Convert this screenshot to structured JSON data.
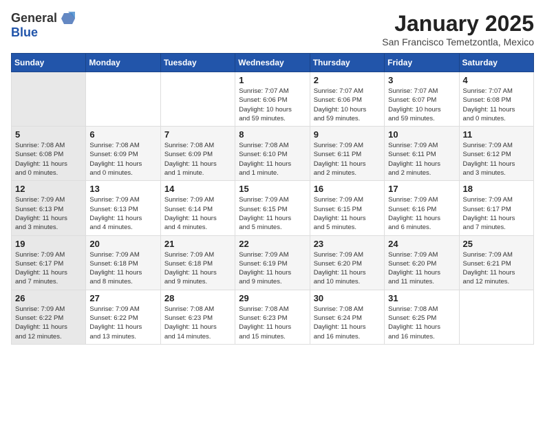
{
  "header": {
    "logo_general": "General",
    "logo_blue": "Blue",
    "month_title": "January 2025",
    "subtitle": "San Francisco Temetzontla, Mexico"
  },
  "weekdays": [
    "Sunday",
    "Monday",
    "Tuesday",
    "Wednesday",
    "Thursday",
    "Friday",
    "Saturday"
  ],
  "weeks": [
    [
      {
        "day": "",
        "info": ""
      },
      {
        "day": "",
        "info": ""
      },
      {
        "day": "",
        "info": ""
      },
      {
        "day": "1",
        "info": "Sunrise: 7:07 AM\nSunset: 6:06 PM\nDaylight: 10 hours\nand 59 minutes."
      },
      {
        "day": "2",
        "info": "Sunrise: 7:07 AM\nSunset: 6:06 PM\nDaylight: 10 hours\nand 59 minutes."
      },
      {
        "day": "3",
        "info": "Sunrise: 7:07 AM\nSunset: 6:07 PM\nDaylight: 10 hours\nand 59 minutes."
      },
      {
        "day": "4",
        "info": "Sunrise: 7:07 AM\nSunset: 6:08 PM\nDaylight: 11 hours\nand 0 minutes."
      }
    ],
    [
      {
        "day": "5",
        "info": "Sunrise: 7:08 AM\nSunset: 6:08 PM\nDaylight: 11 hours\nand 0 minutes."
      },
      {
        "day": "6",
        "info": "Sunrise: 7:08 AM\nSunset: 6:09 PM\nDaylight: 11 hours\nand 0 minutes."
      },
      {
        "day": "7",
        "info": "Sunrise: 7:08 AM\nSunset: 6:09 PM\nDaylight: 11 hours\nand 1 minute."
      },
      {
        "day": "8",
        "info": "Sunrise: 7:08 AM\nSunset: 6:10 PM\nDaylight: 11 hours\nand 1 minute."
      },
      {
        "day": "9",
        "info": "Sunrise: 7:09 AM\nSunset: 6:11 PM\nDaylight: 11 hours\nand 2 minutes."
      },
      {
        "day": "10",
        "info": "Sunrise: 7:09 AM\nSunset: 6:11 PM\nDaylight: 11 hours\nand 2 minutes."
      },
      {
        "day": "11",
        "info": "Sunrise: 7:09 AM\nSunset: 6:12 PM\nDaylight: 11 hours\nand 3 minutes."
      }
    ],
    [
      {
        "day": "12",
        "info": "Sunrise: 7:09 AM\nSunset: 6:13 PM\nDaylight: 11 hours\nand 3 minutes."
      },
      {
        "day": "13",
        "info": "Sunrise: 7:09 AM\nSunset: 6:13 PM\nDaylight: 11 hours\nand 4 minutes."
      },
      {
        "day": "14",
        "info": "Sunrise: 7:09 AM\nSunset: 6:14 PM\nDaylight: 11 hours\nand 4 minutes."
      },
      {
        "day": "15",
        "info": "Sunrise: 7:09 AM\nSunset: 6:15 PM\nDaylight: 11 hours\nand 5 minutes."
      },
      {
        "day": "16",
        "info": "Sunrise: 7:09 AM\nSunset: 6:15 PM\nDaylight: 11 hours\nand 5 minutes."
      },
      {
        "day": "17",
        "info": "Sunrise: 7:09 AM\nSunset: 6:16 PM\nDaylight: 11 hours\nand 6 minutes."
      },
      {
        "day": "18",
        "info": "Sunrise: 7:09 AM\nSunset: 6:17 PM\nDaylight: 11 hours\nand 7 minutes."
      }
    ],
    [
      {
        "day": "19",
        "info": "Sunrise: 7:09 AM\nSunset: 6:17 PM\nDaylight: 11 hours\nand 7 minutes."
      },
      {
        "day": "20",
        "info": "Sunrise: 7:09 AM\nSunset: 6:18 PM\nDaylight: 11 hours\nand 8 minutes."
      },
      {
        "day": "21",
        "info": "Sunrise: 7:09 AM\nSunset: 6:18 PM\nDaylight: 11 hours\nand 9 minutes."
      },
      {
        "day": "22",
        "info": "Sunrise: 7:09 AM\nSunset: 6:19 PM\nDaylight: 11 hours\nand 9 minutes."
      },
      {
        "day": "23",
        "info": "Sunrise: 7:09 AM\nSunset: 6:20 PM\nDaylight: 11 hours\nand 10 minutes."
      },
      {
        "day": "24",
        "info": "Sunrise: 7:09 AM\nSunset: 6:20 PM\nDaylight: 11 hours\nand 11 minutes."
      },
      {
        "day": "25",
        "info": "Sunrise: 7:09 AM\nSunset: 6:21 PM\nDaylight: 11 hours\nand 12 minutes."
      }
    ],
    [
      {
        "day": "26",
        "info": "Sunrise: 7:09 AM\nSunset: 6:22 PM\nDaylight: 11 hours\nand 12 minutes."
      },
      {
        "day": "27",
        "info": "Sunrise: 7:09 AM\nSunset: 6:22 PM\nDaylight: 11 hours\nand 13 minutes."
      },
      {
        "day": "28",
        "info": "Sunrise: 7:08 AM\nSunset: 6:23 PM\nDaylight: 11 hours\nand 14 minutes."
      },
      {
        "day": "29",
        "info": "Sunrise: 7:08 AM\nSunset: 6:23 PM\nDaylight: 11 hours\nand 15 minutes."
      },
      {
        "day": "30",
        "info": "Sunrise: 7:08 AM\nSunset: 6:24 PM\nDaylight: 11 hours\nand 16 minutes."
      },
      {
        "day": "31",
        "info": "Sunrise: 7:08 AM\nSunset: 6:25 PM\nDaylight: 11 hours\nand 16 minutes."
      },
      {
        "day": "",
        "info": ""
      }
    ]
  ]
}
